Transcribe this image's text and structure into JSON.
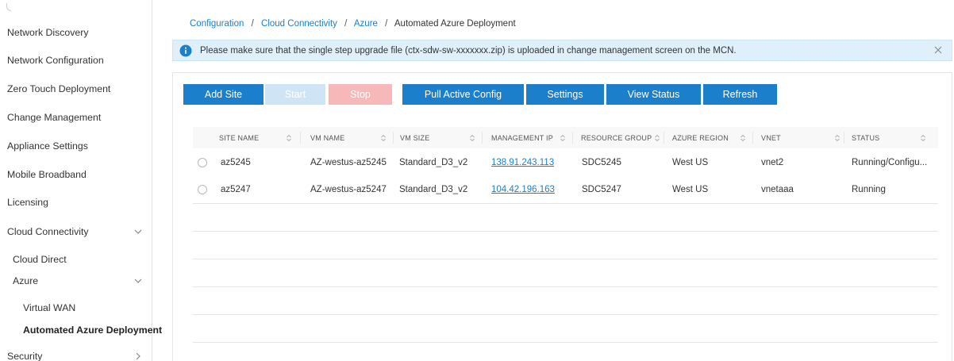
{
  "sidebar": {
    "items": [
      {
        "label": "Network Discovery"
      },
      {
        "label": "Network Configuration"
      },
      {
        "label": "Zero Touch Deployment"
      },
      {
        "label": "Change Management"
      },
      {
        "label": "Appliance Settings"
      },
      {
        "label": "Mobile Broadband"
      },
      {
        "label": "Licensing"
      },
      {
        "label": "Cloud Connectivity",
        "chevron": "chevron-down-icon"
      },
      {
        "label": "Cloud Direct"
      },
      {
        "label": "Azure",
        "chevron": "chevron-down-icon"
      },
      {
        "label": "Virtual WAN"
      },
      {
        "label": "Automated Azure Deployment",
        "active": true
      },
      {
        "label": "Security",
        "chevron": "chevron-right-icon"
      }
    ]
  },
  "breadcrumb": {
    "items": [
      "Configuration",
      "Cloud Connectivity",
      "Azure"
    ],
    "current": "Automated Azure Deployment",
    "separator": "/"
  },
  "info": {
    "message": "Please make sure that the single step upgrade file (ctx-sdw-sw-xxxxxxx.zip) is uploaded in change management screen on the MCN.",
    "icon": "info-icon",
    "close_icon": "close-icon"
  },
  "toolbar": {
    "add_site": "Add Site",
    "start": "Start",
    "stop": "Stop",
    "pull_active_config": "Pull Active Config",
    "settings": "Settings",
    "view_status": "View Status",
    "refresh": "Refresh"
  },
  "table": {
    "columns": [
      "SITE NAME",
      "VM NAME",
      "VM SIZE",
      "MANAGEMENT IP",
      "RESOURCE GROUP",
      "AZURE REGION",
      "VNET",
      "STATUS"
    ],
    "rows": [
      {
        "site_name": "az5245",
        "vm_name": "AZ-westus-az5245",
        "vm_size": "Standard_D3_v2",
        "management_ip": "138.91.243.113",
        "resource_group": "SDC5245",
        "azure_region": "West US",
        "vnet": "vnet2",
        "status": "Running/Configu..."
      },
      {
        "site_name": "az5247",
        "vm_name": "AZ-westus-az5247",
        "vm_size": "Standard_D3_v2",
        "management_ip": "104.42.196.163",
        "resource_group": "SDC5247",
        "azure_region": "West US",
        "vnet": "vnetaaa",
        "status": "Running"
      }
    ]
  },
  "colors": {
    "primary": "#1b7fcc",
    "start_disabled": "#cfe4f5",
    "stop_disabled": "#f6b8b8",
    "info_bg": "#dff0fb"
  }
}
